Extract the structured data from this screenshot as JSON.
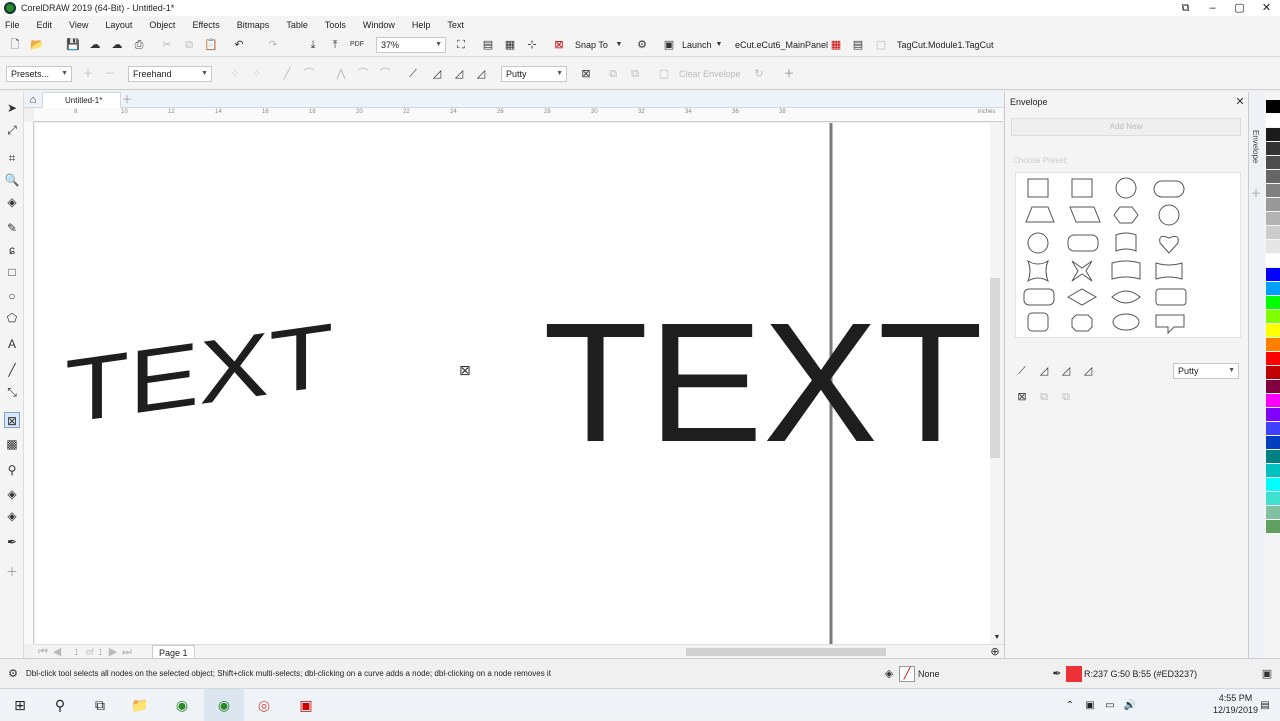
{
  "window": {
    "title": "CorelDRAW 2019 (64-Bit) - Untitled-1*"
  },
  "menu": [
    "File",
    "Edit",
    "View",
    "Layout",
    "Object",
    "Effects",
    "Bitmaps",
    "Table",
    "Tools",
    "Window",
    "Help",
    "Text"
  ],
  "standard_toolbar": {
    "zoom": "37%",
    "snap_to": "Snap To",
    "launch": "Launch",
    "ecut_panel": "eCut.eCut6_MainPanel",
    "tagcut": "TagCut.Module1.TagCut"
  },
  "property_bar": {
    "presets": "Presets...",
    "mode": "Freehand",
    "mapping_mode": "Putty",
    "clear_envelope": "Clear Envelope"
  },
  "doc_tab": {
    "name": "Untitled-1*"
  },
  "ruler_top": [
    "8",
    "10",
    "12",
    "14",
    "16",
    "18",
    "20",
    "22",
    "24",
    "26",
    "28",
    "30",
    "32",
    "34",
    "36",
    "38"
  ],
  "ruler_unit": "inches",
  "canvas": {
    "envelope_text": "TEXT",
    "original_text": "TEXT"
  },
  "page_nav": {
    "page_of": "1",
    "of_label": "of",
    "total": "1",
    "page_tab": "Page 1"
  },
  "docker": {
    "title": "Envelope",
    "add_new": "Add New",
    "choose_preset": "Choose Preset:",
    "mapping_mode": "Putty",
    "side_tab": "Envelope"
  },
  "status": {
    "hint": "Dbl-click tool selects all nodes on the selected object; Shift+click multi-selects; dbl-clicking on a curve adds a node; dbl-clicking on a node removes it",
    "fill": "None",
    "outline_color": "R:237 G:50 B:55 (#ED3237)",
    "outline_hex": "#ED3237"
  },
  "taskbar": {
    "time": "4:55 PM",
    "date": "12/19/2019"
  },
  "palette": [
    "#000000",
    "#ffffff",
    "#1a1a1a",
    "#333333",
    "#4d4d4d",
    "#666666",
    "#808080",
    "#999999",
    "#b3b3b3",
    "#cccccc",
    "#e6e6e6",
    "#ffffff",
    "#0000ff",
    "#00a0ff",
    "#00ff00",
    "#80ff00",
    "#ffff00",
    "#ff8000",
    "#ff0000",
    "#c00000",
    "#800040",
    "#ff00ff",
    "#8000ff",
    "#4040ff",
    "#0040c0",
    "#008080",
    "#00c0c0",
    "#00ffff",
    "#40e0d0",
    "#80c0a0",
    "#60a060"
  ]
}
